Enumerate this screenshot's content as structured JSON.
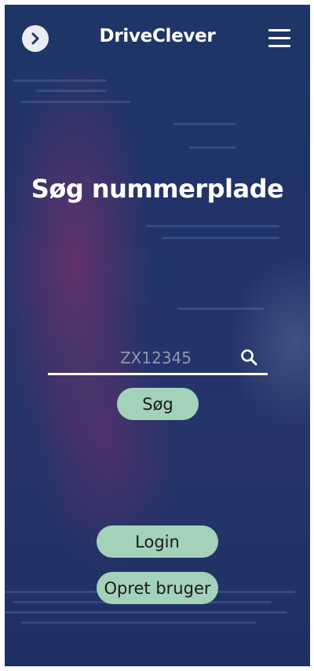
{
  "header": {
    "app_title": "DriveClever",
    "back_icon": "chevron-right-icon",
    "menu_icon": "hamburger-menu-icon"
  },
  "main": {
    "heading": "Søg nummerplade",
    "search": {
      "placeholder": "ZX12345",
      "value": "",
      "icon": "search-icon"
    },
    "search_button_label": "Søg",
    "login_button_label": "Login",
    "signup_button_label": "Opret bruger"
  },
  "colors": {
    "header_bg": "#1f3568",
    "accent_button": "#a3d2b8",
    "text_light": "#ffffff"
  }
}
